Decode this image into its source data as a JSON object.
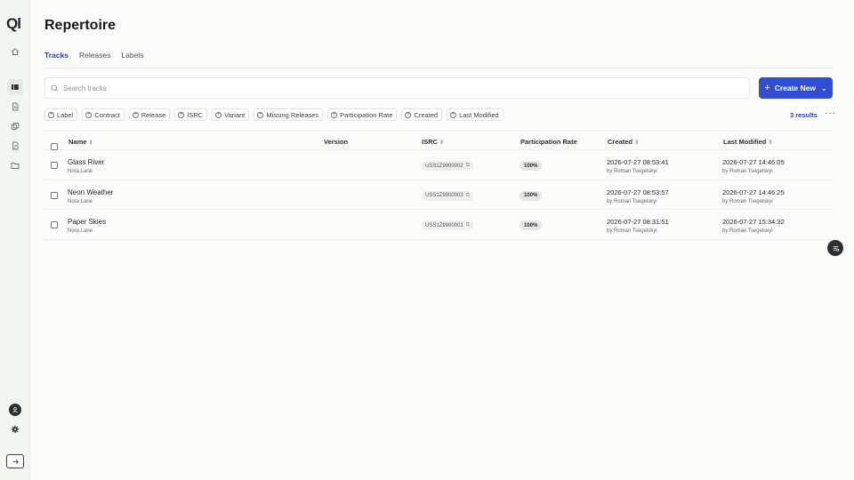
{
  "app": {
    "logo_text": "Ql"
  },
  "sidebar": {
    "icons": [
      "home-icon",
      "catalog-icon",
      "document-icon",
      "stack-icon",
      "file-icon",
      "folder-icon"
    ],
    "bottom": [
      "user-icon",
      "gear-icon",
      "expand-arrow-icon"
    ]
  },
  "page": {
    "title": "Repertoire"
  },
  "tabs": [
    {
      "label": "Tracks",
      "active": true
    },
    {
      "label": "Releases",
      "active": false
    },
    {
      "label": "Labels",
      "active": false
    }
  ],
  "search": {
    "placeholder": "Search tracks"
  },
  "create_button": {
    "label": "Create New"
  },
  "filters": [
    "Label",
    "Contract",
    "Release",
    "ISRC",
    "Variant",
    "Missing Releases",
    "Participation Rate",
    "Created",
    "Last Modified"
  ],
  "results": {
    "count_label": "3 results"
  },
  "more": {
    "label": "···"
  },
  "table": {
    "headers": {
      "name": "Name",
      "version": "Version",
      "isrc": "ISRC",
      "participation_rate": "Participation Rate",
      "created": "Created",
      "last_modified": "Last Modified"
    },
    "rows": [
      {
        "name": "Glass River",
        "artist": "Nora Lane",
        "version": "",
        "isrc": "USS1Z9900002",
        "participation": "100%",
        "created": "2026-07-27 08:53:41",
        "created_by": "by Roman Tsegelskyi",
        "modified": "2026-07-27 14:46:05",
        "modified_by": "by Roman Tsegelskyi"
      },
      {
        "name": "Neon Weather",
        "artist": "Nora Lane",
        "version": "",
        "isrc": "USS1Z9900003",
        "participation": "100%",
        "created": "2026-07-27 08:53:57",
        "created_by": "by Roman Tsegelskyi",
        "modified": "2026-07-27 14:46:25",
        "modified_by": "by Roman Tsegelskyi"
      },
      {
        "name": "Paper Skies",
        "artist": "Nora Lane",
        "version": "",
        "isrc": "USS1Z9900001",
        "participation": "100%",
        "created": "2026-07-27 08:31:51",
        "created_by": "by Roman Tsegelskyi",
        "modified": "2026-07-27 15:34:32",
        "modified_by": "by Roman Tsegelskyi"
      }
    ]
  },
  "colors": {
    "accent": "#2f4ed3",
    "tab_active": "#2742b8",
    "background": "#fbfcf9"
  }
}
